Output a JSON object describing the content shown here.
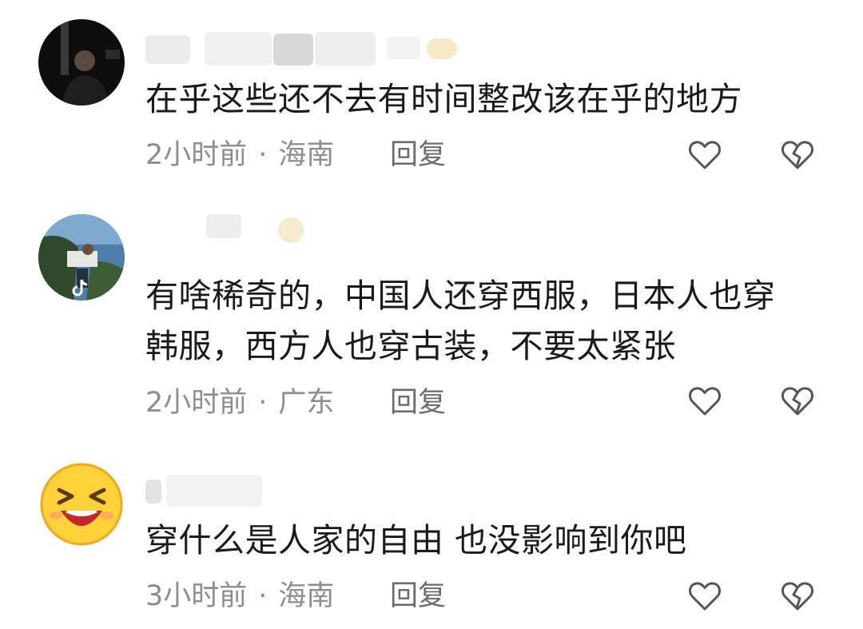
{
  "comments": [
    {
      "text": "在乎这些还不去有时间整改该在乎的地方",
      "time": "2小时前",
      "location": "海南",
      "reply_label": "回复",
      "avatar_icon": "dark-portrait-avatar",
      "like_icon": "heart-outline-icon",
      "dislike_icon": "broken-heart-icon"
    },
    {
      "text": "有啥稀奇的，中国人还穿西服，日本人也穿韩服，西方人也穿古装，不要太紧张",
      "time": "2小时前",
      "location": "广东",
      "reply_label": "回复",
      "avatar_icon": "outdoor-photo-avatar-with-tiktok-logo",
      "like_icon": "heart-outline-icon",
      "dislike_icon": "broken-heart-icon"
    },
    {
      "text": "穿什么是人家的自由 也没影响到你吧",
      "time": "3小时前",
      "location": "海南",
      "reply_label": "回复",
      "avatar_icon": "laughing-emoji-avatar",
      "like_icon": "heart-outline-icon",
      "dislike_icon": "broken-heart-icon"
    }
  ],
  "colors": {
    "text": "#1a1a1a",
    "meta": "#8d8d8d",
    "icon": "#555555"
  }
}
